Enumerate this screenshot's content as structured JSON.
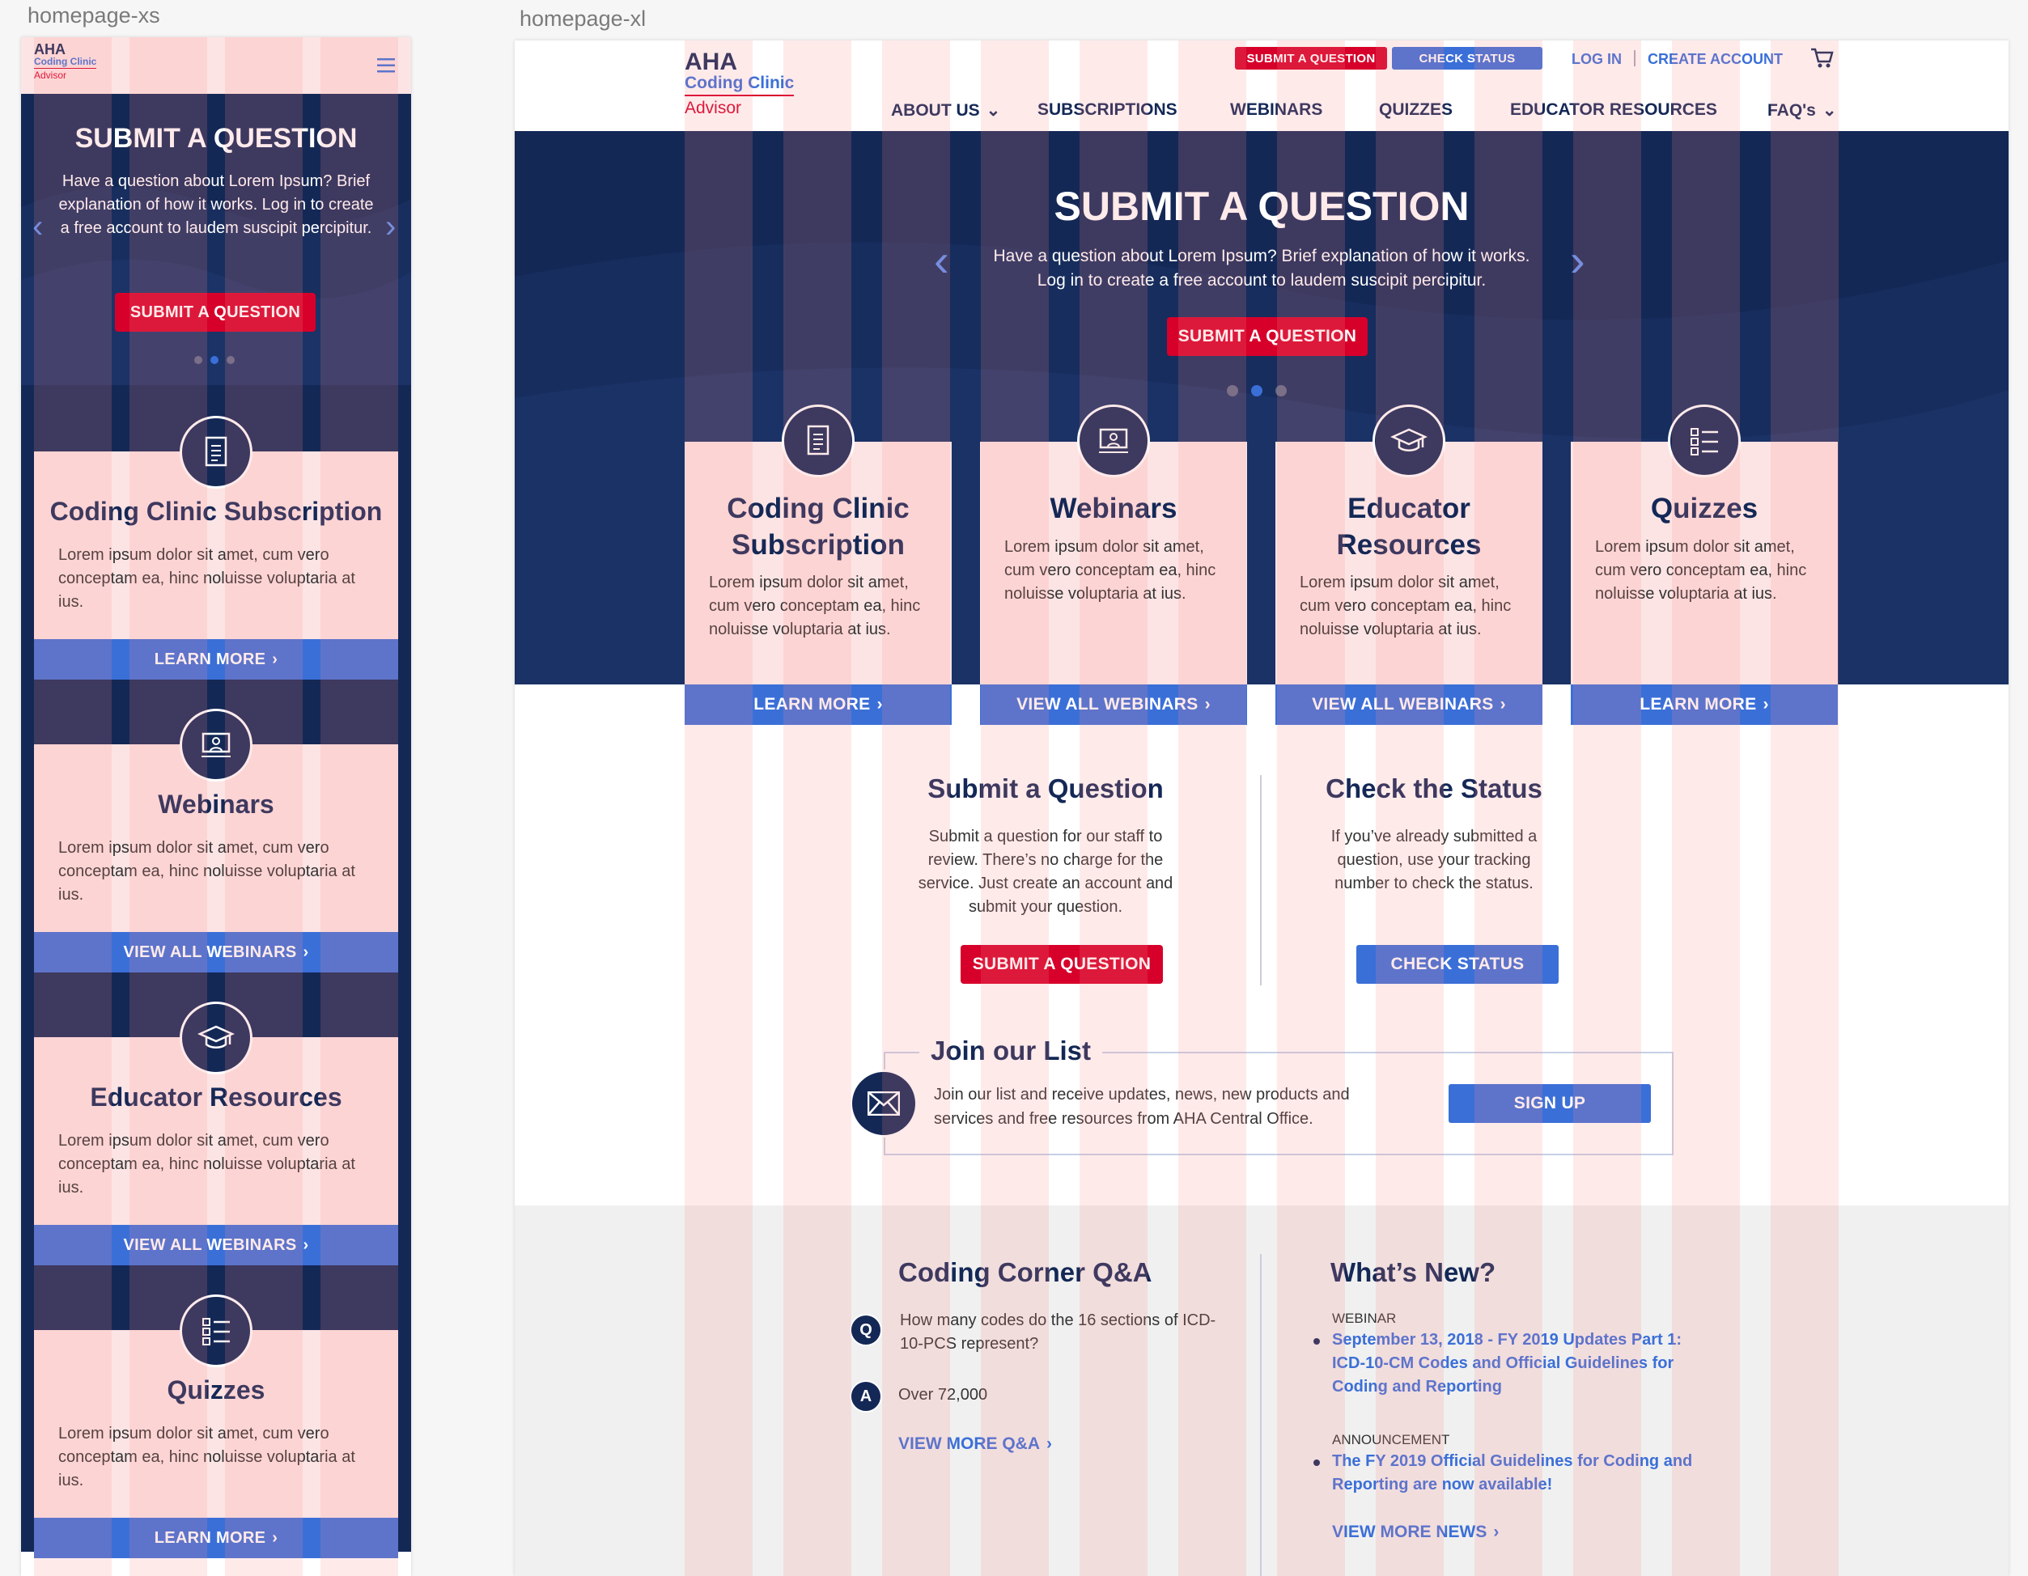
{
  "frames": {
    "xs_label": "homepage-xs",
    "xl_label": "homepage-xl"
  },
  "colors": {
    "navy": "#142856",
    "red": "#d6002a",
    "blue": "#3b6fd8",
    "card": "#fde4e4",
    "link": "#3b6fd8"
  },
  "logo": {
    "line1": "AHA",
    "line2": "Coding Clinic",
    "line3": "Advisor"
  },
  "header": {
    "submit_label": "SUBMIT A QUESTION",
    "status_label": "CHECK STATUS",
    "login_label": "LOG IN",
    "create_label": "CREATE ACCOUNT",
    "cart_icon": "cart-icon",
    "menu_icon": "hamburger-icon"
  },
  "nav": {
    "about": "ABOUT US",
    "subscriptions": "SUBSCRIPTIONS",
    "webinars": "WEBINARS",
    "quizzes": "QUIZZES",
    "educator": "EDUCATOR RESOURCES",
    "faq": "FAQ's"
  },
  "hero": {
    "title": "SUBMIT A QUESTION",
    "text": "Have a question about Lorem Ipsum? Brief explanation of how it works. Log in to create a free account to laudem suscipit percipitur.",
    "button": "SUBMIT A QUESTION",
    "active_slide": 2,
    "total_slides": 3
  },
  "cards": [
    {
      "title": "Coding Clinic Subscription",
      "text": "Lorem ipsum dolor sit amet, cum vero conceptam ea, hinc noluisse voluptaria at ius.",
      "button": "LEARN MORE",
      "icon": "document-icon"
    },
    {
      "title": "Webinars",
      "text": "Lorem ipsum dolor sit amet, cum vero conceptam ea, hinc noluisse voluptaria at ius.",
      "button": "VIEW ALL WEBINARS",
      "icon": "presentation-icon"
    },
    {
      "title": "Educator Resources",
      "text": "Lorem ipsum dolor sit amet, cum vero conceptam ea, hinc noluisse voluptaria at ius.",
      "button": "VIEW ALL WEBINARS",
      "icon": "graduation-cap-icon"
    },
    {
      "title": "Quizzes",
      "text": "Lorem ipsum dolor sit amet, cum vero conceptam ea, hinc noluisse voluptaria at ius.",
      "button": "LEARN MORE",
      "icon": "checklist-icon"
    }
  ],
  "submit_section": {
    "title": "Submit a Question",
    "text": "Submit a question for our staff to review. There’s no charge for the service. Just create an account and submit your question.",
    "button": "SUBMIT A QUESTION"
  },
  "status_section": {
    "title": "Check the Status",
    "text": "If you’ve already submitted a question, use your tracking number to check the status.",
    "button": "CHECK STATUS"
  },
  "join": {
    "title": "Join our List",
    "text": "Join our list and receive updates, news, new products and services and free resources from AHA Central Office.",
    "button": "SIGN UP",
    "icon": "envelope-icon"
  },
  "qa": {
    "title": "Coding Corner Q&A",
    "q_badge": "Q",
    "question": "How many codes do the 16 sections of ICD-10-PCS represent?",
    "a_badge": "A",
    "answer": "Over 72,000",
    "more": "VIEW MORE Q&A"
  },
  "news": {
    "title": "What’s New?",
    "items": [
      {
        "category": "WEBINAR",
        "text": "September 13, 2018 - FY 2019 Updates Part 1: ICD-10-CM Codes and Official Guidelines for Coding and Reporting"
      },
      {
        "category": "ANNOUNCEMENT",
        "text": "The FY 2019 Official Guidelines for Coding and Reporting are now available!"
      }
    ],
    "more": "VIEW MORE NEWS"
  }
}
